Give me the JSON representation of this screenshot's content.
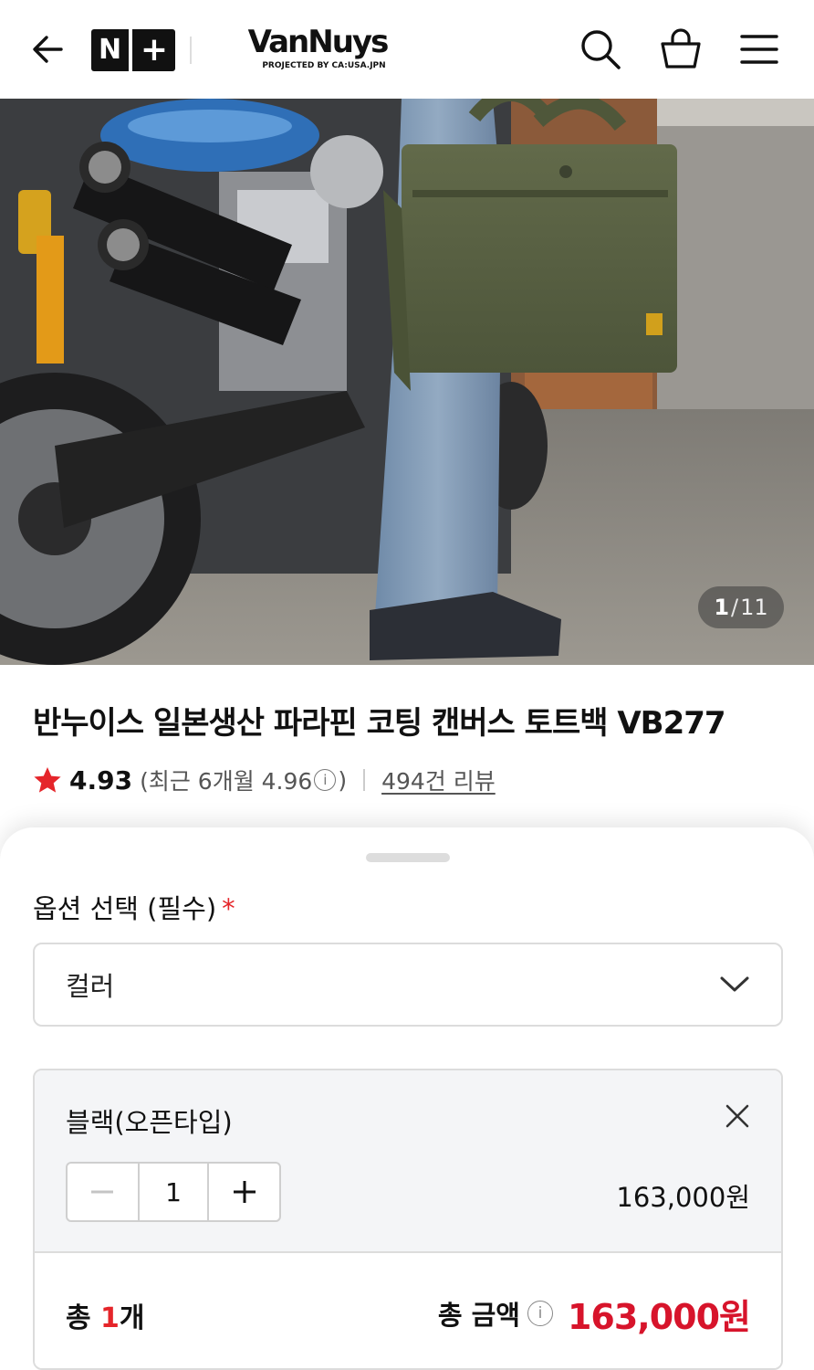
{
  "header": {
    "brand_badge_left": "N",
    "brand_badge_right": "+",
    "brand_name": "VanNuys",
    "brand_tagline": "PROJECTED BY CA:USA.JPN",
    "icons": [
      "back-arrow-icon",
      "search-icon",
      "shopping-bag-icon",
      "hamburger-menu-icon"
    ]
  },
  "gallery": {
    "current": "1",
    "separator": "/",
    "total": "11"
  },
  "product": {
    "title": "반누이스 일본생산 파라핀 코팅 캔버스 토트백 VB277",
    "rating": "4.93",
    "recent_prefix": "(최근 6개월 4.96",
    "recent_suffix": ")",
    "info_glyph": "i",
    "review_count": "494건 리뷰"
  },
  "sheet": {
    "option_label": "옵션 선택 (필수)",
    "required_mark": "*",
    "select_value": "컬러",
    "selected_option": {
      "name": "블랙(오픈타입)",
      "quantity": "1",
      "price": "163,000원"
    },
    "total": {
      "count_prefix": "총 ",
      "count": "1",
      "count_suffix": "개",
      "amount_label": "총 금액",
      "amount": "163,000원"
    }
  },
  "colors": {
    "accent_red": "#d7142b",
    "star_red": "#e5252a",
    "border": "#dcdcdc",
    "option_bg": "#f4f5f7"
  }
}
